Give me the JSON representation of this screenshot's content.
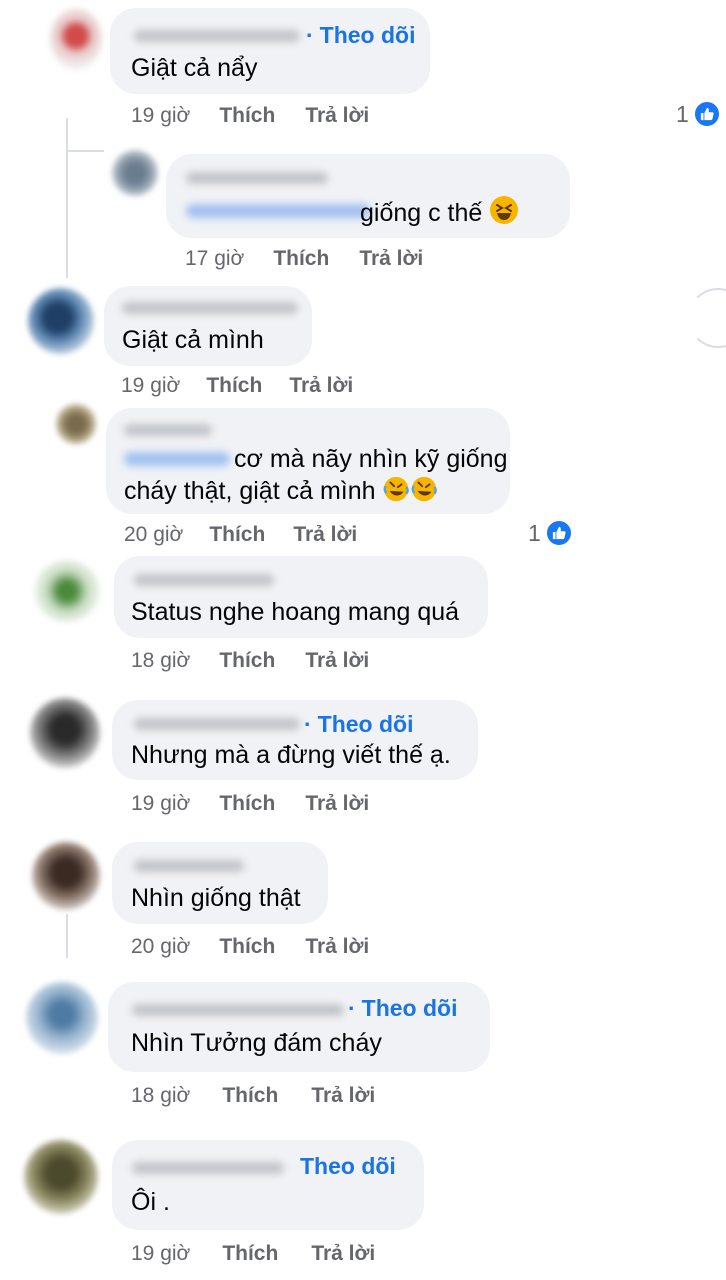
{
  "follow_label": "Theo dõi",
  "like_label": "Thích",
  "reply_label": "Trả lời",
  "colors": {
    "bubble": "#f0f2f5",
    "link_blue": "#1b74e4",
    "meta_grey": "#65676b",
    "like_blue": "#1877f2"
  },
  "comments": [
    {
      "text": "Giật cả nẩy",
      "time": "19 giờ",
      "follow": true,
      "reactions": "1"
    },
    {
      "text": "giống c thế",
      "time": "17 giờ",
      "follow": false,
      "reply": true,
      "emoji": "grinning-squinting-face"
    },
    {
      "text": "Giật cả mình",
      "time": "19 giờ",
      "follow": false
    },
    {
      "text_line1": "cơ mà nãy nhìn kỹ giống",
      "text_line2": "cháy thật, giật cả mình",
      "time": "20 giờ",
      "follow": false,
      "reactions": "1",
      "emoji": "rolling-on-floor-laughing"
    },
    {
      "text": "Status nghe hoang mang quá",
      "time": "18 giờ",
      "follow": false
    },
    {
      "text": "Nhưng mà a đừng viết thế ạ.",
      "time": "19 giờ",
      "follow": true
    },
    {
      "text": "Nhìn giống thật",
      "time": "20 giờ",
      "follow": false
    },
    {
      "text": "Nhìn Tưởng đám cháy",
      "time": "18 giờ",
      "follow": true
    },
    {
      "text": "Ôi .",
      "time": "19 giờ",
      "follow": true
    }
  ]
}
